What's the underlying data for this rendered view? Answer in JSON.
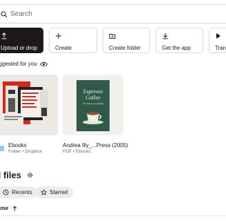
{
  "search": {
    "placeholder": "Search",
    "icon": "search-icon"
  },
  "actions": [
    {
      "label": "Upload or drop",
      "icon": "upload-icon",
      "primary": true
    },
    {
      "label": "Create",
      "icon": "plus-icon"
    },
    {
      "label": "Create folder",
      "icon": "folder-plus-icon"
    },
    {
      "label": "Get the app",
      "icon": "download-icon"
    },
    {
      "label": "Trans",
      "icon": "transfer-icon"
    }
  ],
  "suggested": {
    "title": "uggested for you",
    "icon": "eye-icon",
    "items": [
      {
        "name": "Ebooks",
        "meta": "Folder • Dropbox",
        "kind": "folder"
      },
      {
        "name": "Andrea Illy_...Press (2005)",
        "meta": "PDF • Ebooks",
        "kind": "pdf",
        "cover_title": "Espresso\nCoffee",
        "cover_sub": "The Science of Quality"
      }
    ]
  },
  "all_files": {
    "title": "ll files",
    "settings_icon": "gear-icon",
    "filters": [
      {
        "label": "Recents",
        "icon": "clock-icon"
      },
      {
        "label": "Starred",
        "icon": "star-icon"
      }
    ],
    "sort": {
      "label": "ame",
      "icon": "arrow-up-icon"
    }
  },
  "colors": {
    "primary": "#1e1919",
    "chip": "#efebe7",
    "folder": "#9cc7ff",
    "cover": "#2f5a4a"
  }
}
